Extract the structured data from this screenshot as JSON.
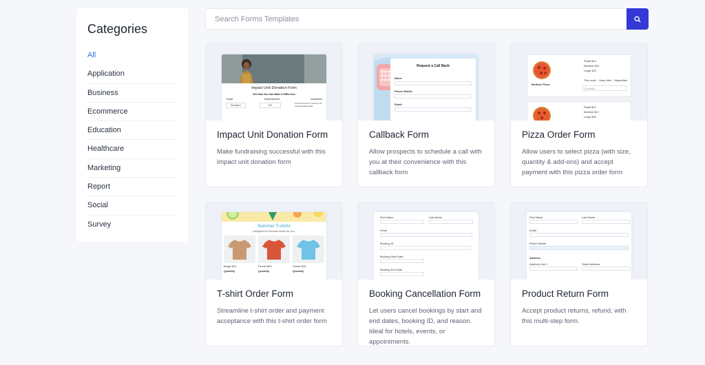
{
  "sidebar": {
    "title": "Categories",
    "items": [
      "All",
      "Application",
      "Business",
      "Ecommerce",
      "Education",
      "Healthcare",
      "Marketing",
      "Report",
      "Social",
      "Survey"
    ]
  },
  "search": {
    "placeholder": "Search Forms Templates"
  },
  "icons": {
    "search_button": "search-icon"
  },
  "colors": {
    "accent": "#3338d6",
    "active_category": "#2b6fd6"
  },
  "cards": [
    {
      "title": "Impact Unit Donation Form",
      "description": "Make fundraising successful with this impact unit donation form",
      "preview": {
        "heading": "Impact Unit Donation Form",
        "subheading": "See How You Can Make a Difference",
        "columns": [
          "Cause",
          "Disbursement",
          "Impactium"
        ],
        "row": [
          "Education",
          "100",
          "Funds 10 hours of tutoring for underprivileged kids"
        ]
      }
    },
    {
      "title": "Callback Form",
      "description": "Allow prospects to schedule a call with you at their convenience with this callback form",
      "preview": {
        "heading": "Request a Call Back",
        "labels": [
          "Name",
          "Phone Mobile",
          "Email"
        ]
      }
    },
    {
      "title": "Pizza Order Form",
      "description": "Allow users to select pizza (with size, quantity & add-ons) and accept payment with this pizza order form",
      "preview": {
        "sizes": [
          "Small $10",
          "Medium $15",
          "Large $20"
        ],
        "item_name": "Medium Pizza",
        "options": [
          "Thin crust",
          "Deep dish",
          "Neapolitan"
        ],
        "quantity_label": "Quantity",
        "sizes_2": [
          "Small $12",
          "Medium $17",
          "Large $22"
        ]
      }
    },
    {
      "title": "T-shirt Order Form",
      "description": "Streamline t-shirt order and payment acceptance with this t-shirt order form",
      "preview": {
        "heading": "Summer T-shirts",
        "subheading": "Designed for Summer Mode for You.",
        "items": [
          "Beige $15",
          "Ferrari $25",
          "Ocean $15"
        ],
        "quantity_label": "Quantity"
      }
    },
    {
      "title": "Booking Cancellation Form",
      "description": "Let users cancel bookings by start and end dates, booking ID, and reason. Ideal for hotels, events, or appointments.",
      "preview": {
        "labels": [
          "First Name",
          "Last Name",
          "Email",
          "Booking ID",
          "Booking Start Date",
          "Booking End Date"
        ]
      }
    },
    {
      "title": "Product Return Form",
      "description": "Accept product returns, refund, with this multi-step form.",
      "preview": {
        "labels": [
          "First Name",
          "Last Name",
          "Email",
          "Phone Mobile",
          "Address",
          "Address Line 1",
          "Street Address"
        ]
      }
    }
  ]
}
